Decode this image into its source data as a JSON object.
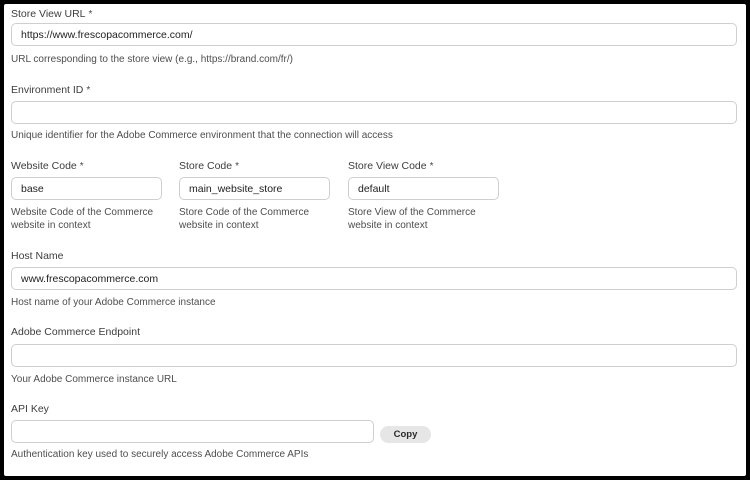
{
  "form": {
    "store_view_url": {
      "label": "Store View URL",
      "required_mark": "*",
      "value": "https://www.frescopacommerce.com/",
      "help": "URL corresponding to the store view (e.g., https://brand.com/fr/)"
    },
    "environment_id": {
      "label": "Environment ID",
      "required_mark": "*",
      "value": "",
      "help": "Unique identifier for the Adobe Commerce environment that the connection will access"
    },
    "website_code": {
      "label": "Website Code",
      "required_mark": "*",
      "value": "base",
      "help_line1": "Website Code of the Commerce",
      "help_line2": "website in context"
    },
    "store_code": {
      "label": "Store Code",
      "required_mark": "*",
      "value": "main_website_store",
      "help_line1": "Store Code of the Commerce",
      "help_line2": "website in context"
    },
    "store_view_code": {
      "label": "Store View Code",
      "required_mark": "*",
      "value": "default",
      "help_line1": "Store View of the Commerce",
      "help_line2": "website in context"
    },
    "host_name": {
      "label": "Host Name",
      "value": "www.frescopacommerce.com",
      "help": "Host name of your Adobe Commerce instance"
    },
    "endpoint": {
      "label": "Adobe Commerce Endpoint",
      "value": "",
      "help": "Your Adobe Commerce instance URL"
    },
    "api_key": {
      "label": "API Key",
      "value": "",
      "copy_label": "Copy",
      "help": "Authentication key used to securely access Adobe Commerce APIs"
    }
  }
}
